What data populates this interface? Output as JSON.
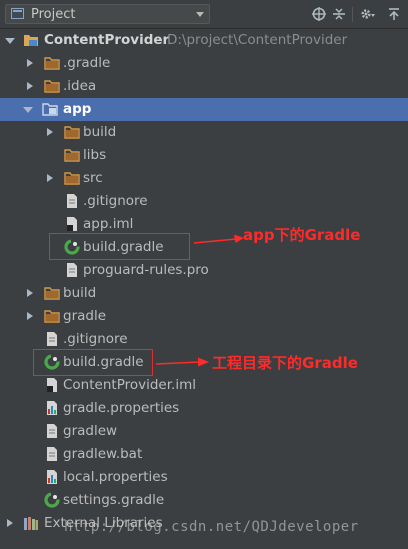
{
  "header": {
    "title": "Project"
  },
  "tree": [
    {
      "label": "ContentProvider",
      "path": "D:\\project\\ContentProvider",
      "icon": "project-folder-icon",
      "arrow": "down",
      "bold": true
    },
    {
      "label": ".gradle",
      "icon": "folder-icon",
      "arrow": "right"
    },
    {
      "label": ".idea",
      "icon": "folder-icon",
      "arrow": "right"
    },
    {
      "label": "app",
      "icon": "module-folder-icon",
      "arrow": "down",
      "selected": true
    },
    {
      "label": "build",
      "icon": "folder-icon",
      "arrow": "right"
    },
    {
      "label": "libs",
      "icon": "folder-icon",
      "arrow": ""
    },
    {
      "label": "src",
      "icon": "folder-icon",
      "arrow": "right"
    },
    {
      "label": ".gitignore",
      "icon": "text-file-icon",
      "arrow": ""
    },
    {
      "label": "app.iml",
      "icon": "iml-file-icon",
      "arrow": ""
    },
    {
      "label": "build.gradle",
      "icon": "gradle-file-icon",
      "arrow": ""
    },
    {
      "label": "proguard-rules.pro",
      "icon": "text-file-icon",
      "arrow": ""
    },
    {
      "label": "build",
      "icon": "folder-icon",
      "arrow": "right"
    },
    {
      "label": "gradle",
      "icon": "folder-icon",
      "arrow": "right"
    },
    {
      "label": ".gitignore",
      "icon": "text-file-icon",
      "arrow": ""
    },
    {
      "label": "build.gradle",
      "icon": "gradle-file-icon",
      "arrow": ""
    },
    {
      "label": "ContentProvider.iml",
      "icon": "iml-file-icon",
      "arrow": ""
    },
    {
      "label": "gradle.properties",
      "icon": "properties-file-icon",
      "arrow": ""
    },
    {
      "label": "gradlew",
      "icon": "text-file-icon",
      "arrow": ""
    },
    {
      "label": "gradlew.bat",
      "icon": "text-file-icon",
      "arrow": ""
    },
    {
      "label": "local.properties",
      "icon": "properties-file-icon",
      "arrow": ""
    },
    {
      "label": "settings.gradle",
      "icon": "gradle-file-icon",
      "arrow": ""
    },
    {
      "label": "External Libraries",
      "icon": "libraries-icon",
      "arrow": "right"
    }
  ],
  "annotations": {
    "app_gradle": "app下的Gradle",
    "project_gradle": "工程目录下的Gradle",
    "color": "#ff2a2a"
  },
  "watermark": "http://blog.csdn.net/QDJdeveloper",
  "colors": {
    "background": "#3c3f41",
    "selection": "#4b6eaf",
    "text": "#bbbbbb"
  }
}
